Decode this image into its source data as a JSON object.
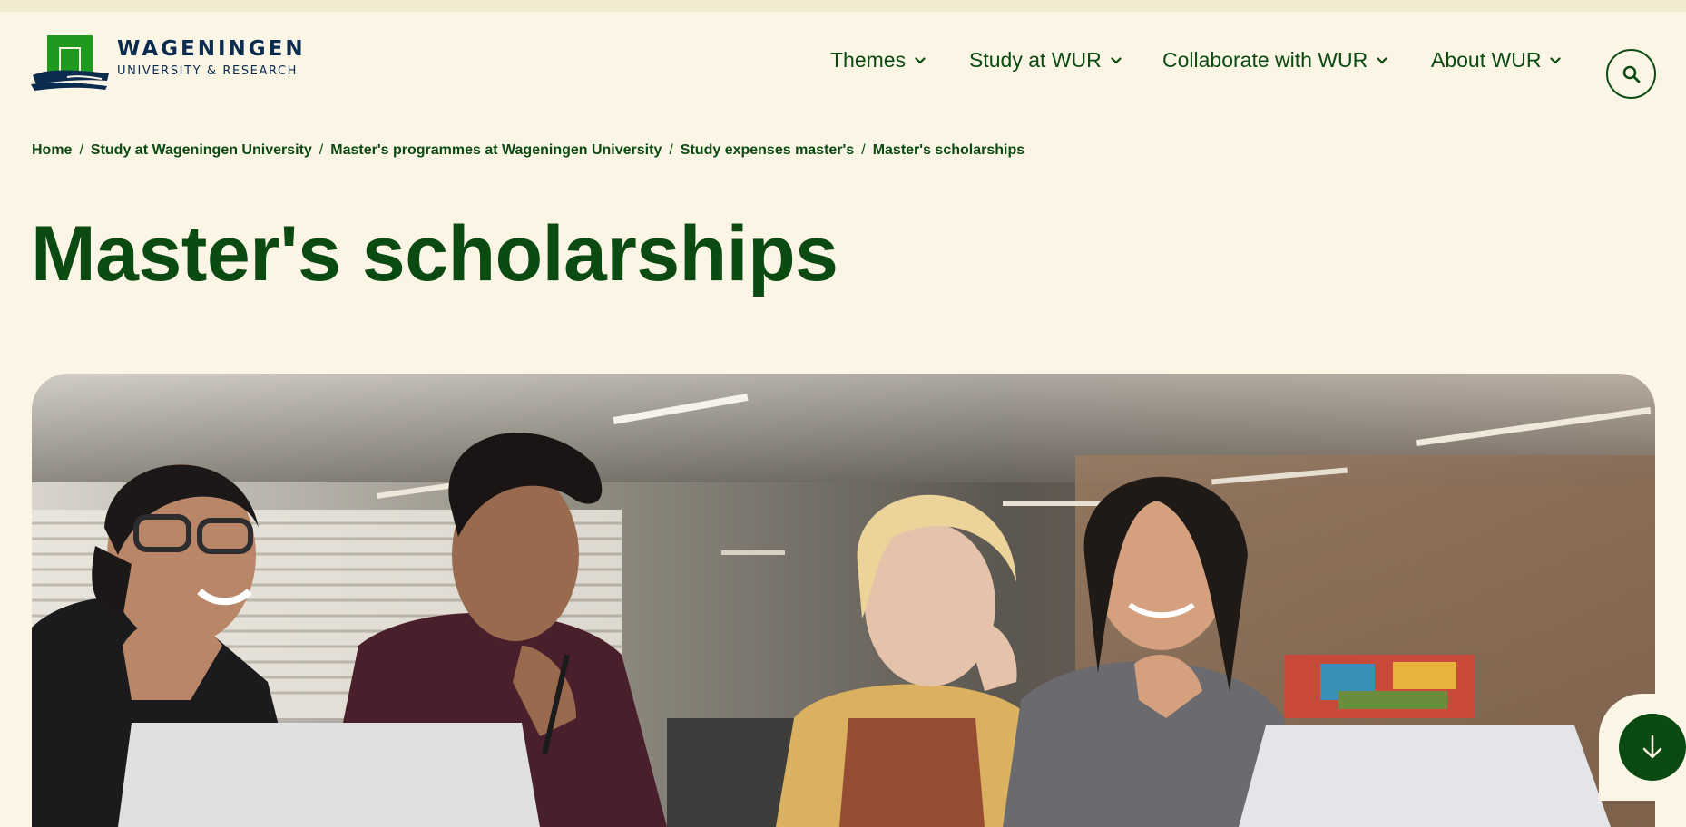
{
  "logo": {
    "name": "WAGENINGEN",
    "subtitle": "UNIVERSITY & RESEARCH"
  },
  "nav": {
    "items": [
      {
        "label": "Themes",
        "icon": "chevron-down-icon"
      },
      {
        "label": "Study at WUR",
        "icon": "chevron-down-icon"
      },
      {
        "label": "Collaborate with WUR",
        "icon": "chevron-down-icon"
      },
      {
        "label": "About WUR",
        "icon": "chevron-down-icon"
      }
    ],
    "search_icon": "search-icon"
  },
  "breadcrumb": {
    "items": [
      "Home",
      "Study at Wageningen University",
      "Master's programmes at Wageningen University",
      "Study expenses master's",
      "Master's scholarships"
    ],
    "separator": "/"
  },
  "page": {
    "title": "Master's scholarships"
  },
  "hero": {
    "icon": "hero-photo"
  },
  "scroll_button": {
    "icon": "arrow-down-icon"
  },
  "colors": {
    "background": "#fbf5e6",
    "top_strip": "#f3ead2",
    "brand_green": "#0b4a10",
    "logo_green": "#1e9b1e",
    "logo_navy": "#0b2b4f"
  }
}
